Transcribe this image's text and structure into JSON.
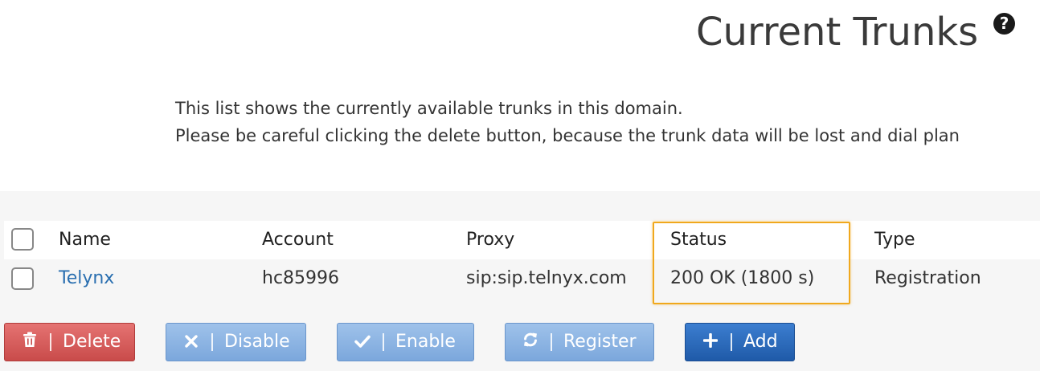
{
  "page": {
    "title": "Current Trunks",
    "help_icon": "question-circle-icon",
    "help_glyph": "?"
  },
  "intro": {
    "line1": "This list shows the currently available trunks in this domain.",
    "line2": "Please be careful clicking the delete button, because the trunk data will be lost and dial plan"
  },
  "table": {
    "columns": [
      "Name",
      "Account",
      "Proxy",
      "Status",
      "Type"
    ],
    "rows": [
      {
        "name": "Telynx",
        "account": "hc85996",
        "proxy": "sip:sip.telnyx.com",
        "status": "200 OK (1800 s)",
        "type": "Registration"
      }
    ]
  },
  "toolbar": {
    "delete_label": "Delete",
    "disable_label": "Disable",
    "enable_label": "Enable",
    "register_label": "Register",
    "add_label": "Add"
  },
  "colors": {
    "highlight": "#f0a81d",
    "link": "#2a6fb0",
    "delete": "#c94b4a",
    "secondary": "#7ba7dc",
    "primary": "#1f5aa8"
  }
}
